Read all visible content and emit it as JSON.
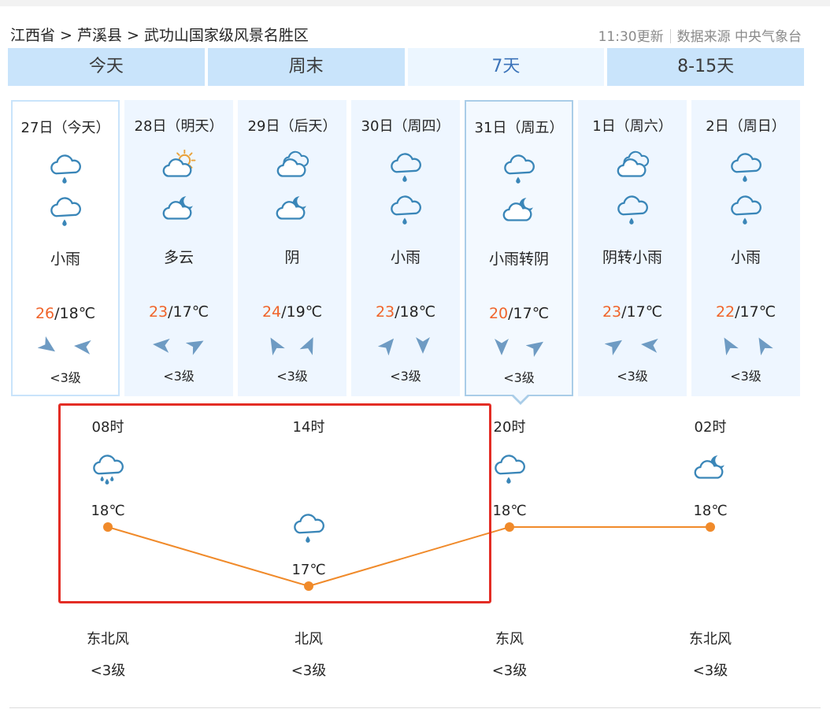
{
  "breadcrumb": {
    "province": "江西省",
    "county": "芦溪县",
    "location": "武功山国家级风景名胜区",
    "separator": ">"
  },
  "update": {
    "time_text": "11:30更新",
    "source_text": "数据来源 中央气象台"
  },
  "tabs": [
    {
      "label": "今天"
    },
    {
      "label": "周末"
    },
    {
      "label": "7天",
      "active": true
    },
    {
      "label": "8-15天"
    }
  ],
  "colors": {
    "accent": "#3b73b9",
    "tab_bg": "#c9e4fb",
    "high_temp": "#f0642a",
    "line": "#f08a2a",
    "icon": "#3a86b8",
    "highlight": "#e32d25"
  },
  "days": [
    {
      "date": "27日（今天）",
      "icon_day": "light-rain-icon",
      "icon_night": "light-rain-icon",
      "desc": "小雨",
      "high": "26",
      "low": "/18℃",
      "level": "<3级"
    },
    {
      "date": "28日（明天）",
      "icon_day": "partly-cloudy-day-icon",
      "icon_night": "partly-cloudy-night-icon",
      "desc": "多云",
      "high": "23",
      "low": "/17℃",
      "level": "<3级"
    },
    {
      "date": "29日（后天）",
      "icon_day": "overcast-icon",
      "icon_night": "partly-cloudy-night-icon",
      "desc": "阴",
      "high": "24",
      "low": "/19℃",
      "level": "<3级"
    },
    {
      "date": "30日（周四）",
      "icon_day": "light-rain-icon",
      "icon_night": "light-rain-icon",
      "desc": "小雨",
      "high": "23",
      "low": "/18℃",
      "level": "<3级"
    },
    {
      "date": "31日（周五）",
      "icon_day": "light-rain-icon",
      "icon_night": "partly-cloudy-night-icon",
      "desc": "小雨转阴",
      "high": "20",
      "low": "/17℃",
      "level": "<3级"
    },
    {
      "date": "1日（周六）",
      "icon_day": "overcast-icon",
      "icon_night": "light-rain-icon",
      "desc": "阴转小雨",
      "high": "23",
      "low": "/17℃",
      "level": "<3级"
    },
    {
      "date": "2日（周日）",
      "icon_day": "light-rain-icon",
      "icon_night": "light-rain-icon",
      "desc": "小雨",
      "high": "22",
      "low": "/17℃",
      "level": "<3级"
    }
  ],
  "hourly": [
    {
      "time": "08时",
      "icon": "moderate-rain-icon",
      "temp": "18℃",
      "wind": "东北风",
      "level": "<3级"
    },
    {
      "time": "14时",
      "icon": "light-rain-icon",
      "temp": "17℃",
      "wind": "北风",
      "level": "<3级"
    },
    {
      "time": "20时",
      "icon": "light-rain-icon",
      "temp": "18℃",
      "wind": "东风",
      "level": "<3级"
    },
    {
      "time": "02时",
      "icon": "partly-cloudy-night-icon",
      "temp": "18℃",
      "wind": "东北风",
      "level": "<3级"
    }
  ],
  "chart_data": {
    "type": "line",
    "categories": [
      "08时",
      "14时",
      "20时",
      "02时"
    ],
    "values": [
      18,
      17,
      18,
      18
    ],
    "unit": "℃"
  }
}
